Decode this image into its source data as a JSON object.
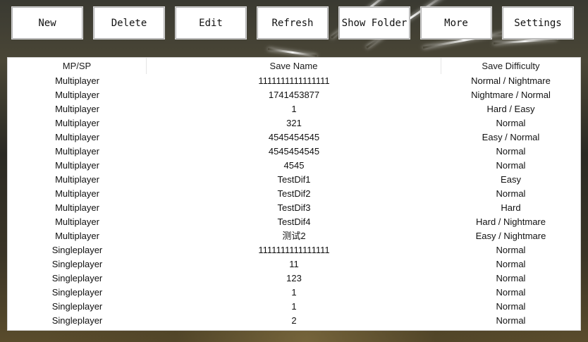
{
  "toolbar": {
    "buttons": [
      {
        "id": "new",
        "label": "New"
      },
      {
        "id": "delete",
        "label": "Delete"
      },
      {
        "id": "edit",
        "label": "Edit"
      },
      {
        "id": "refresh",
        "label": "Refresh"
      },
      {
        "id": "show-folder",
        "label": "Show Folder"
      },
      {
        "id": "more",
        "label": "More"
      },
      {
        "id": "settings",
        "label": "Settings"
      }
    ]
  },
  "table": {
    "columns": [
      "MP/SP",
      "Save Name",
      "Save Difficulty"
    ],
    "rows": [
      [
        "Multiplayer",
        "1111111111111111",
        "Normal / Nightmare"
      ],
      [
        "Multiplayer",
        "1741453877",
        "Nightmare / Normal"
      ],
      [
        "Multiplayer",
        "1",
        "Hard / Easy"
      ],
      [
        "Multiplayer",
        "321",
        "Normal"
      ],
      [
        "Multiplayer",
        "4545454545",
        "Easy / Normal"
      ],
      [
        "Multiplayer",
        "4545454545",
        "Normal"
      ],
      [
        "Multiplayer",
        "4545",
        "Normal"
      ],
      [
        "Multiplayer",
        "TestDif1",
        "Easy"
      ],
      [
        "Multiplayer",
        "TestDif2",
        "Normal"
      ],
      [
        "Multiplayer",
        "TestDif3",
        "Hard"
      ],
      [
        "Multiplayer",
        "TestDif4",
        "Hard / Nightmare"
      ],
      [
        "Multiplayer",
        "测试2",
        "Easy / Nightmare"
      ],
      [
        "Singleplayer",
        "1111111111111111",
        "Normal"
      ],
      [
        "Singleplayer",
        "11",
        "Normal"
      ],
      [
        "Singleplayer",
        "123",
        "Normal"
      ],
      [
        "Singleplayer",
        "1",
        "Normal"
      ],
      [
        "Singleplayer",
        "1",
        "Normal"
      ],
      [
        "Singleplayer",
        "2",
        "Normal"
      ]
    ]
  }
}
